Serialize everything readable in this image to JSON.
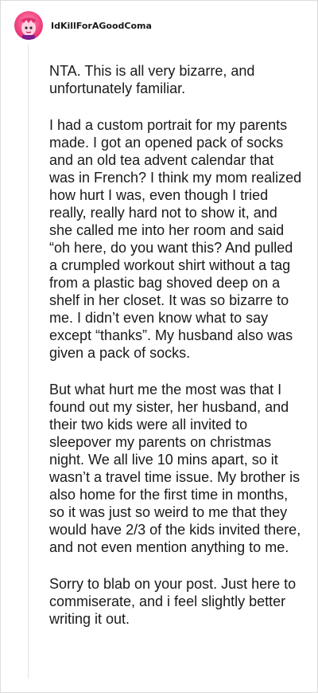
{
  "post": {
    "username": "IdKillForAGoodComa",
    "avatar_icon": "pink-cartoon-avatar-icon",
    "accent_color": "#f0437f",
    "paragraphs": [
      "NTA. This is all very bizarre, and unfortunately familiar.",
      "I had a custom portrait for my parents made. I got an opened pack of socks and an old tea advent calendar that was in French? I think my mom realized how hurt I was, even though I tried really, really hard not to show it, and she called me into her room and said “oh here, do you want this? And pulled a crumpled workout shirt without a tag from a plastic bag shoved deep on a shelf in her closet. It was so bizarre to me. I didn’t even know what to say except “thanks”. My husband also was given a pack of socks.",
      "But what hurt me the most was that I found out my sister, her husband, and their two kids were all invited to sleepover my parents on christmas night. We all live 10 mins apart, so it wasn’t a travel time issue. My brother is also home for the first time in months, so it was just so weird to me that they would have 2/3 of the kids invited there, and not even mention anything to me.",
      "Sorry to blab on your post. Just here to commiserate, and i feel slightly better writing it out."
    ]
  }
}
